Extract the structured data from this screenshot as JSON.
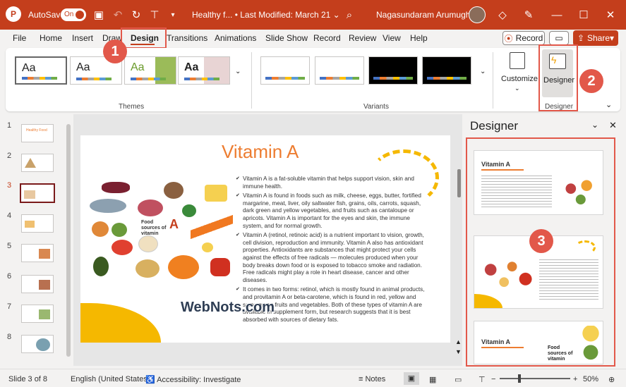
{
  "titlebar": {
    "autosave_label": "AutoSave",
    "autosave_state": "On",
    "doc_title": "Healthy f...",
    "last_modified": "Last Modified: March 21",
    "user_name": "Nagasundaram Arumugham"
  },
  "menu": {
    "tabs": [
      "File",
      "Home",
      "Insert",
      "Draw",
      "Design",
      "Transitions",
      "Animations",
      "Slide Show",
      "Record",
      "Review",
      "View",
      "Help"
    ],
    "active": "Design",
    "record_btn": "Record",
    "share_btn": "Share"
  },
  "ribbon": {
    "themes_label": "Themes",
    "variants_label": "Variants",
    "customize_label": "Customize",
    "designer_label": "Designer",
    "designer_group_label": "Designer",
    "theme_aa": "Aa"
  },
  "badges": [
    "1",
    "2",
    "3"
  ],
  "slides": {
    "numbers": [
      "1",
      "2",
      "3",
      "4",
      "5",
      "6",
      "7",
      "8"
    ],
    "active": "3",
    "thumb1_text": "Healthy Food"
  },
  "slide": {
    "title": "Vitamin A",
    "food_label": "Food sources of vitamin",
    "food_letter": "A",
    "bullets": [
      "Vitamin A is a fat-soluble vitamin that helps support vision, skin and immune health.",
      "Vitamin A is found in foods such as milk, cheese, eggs, butter, fortified margarine, meat, liver, oily saltwater fish, grains, oils, carrots, squash, dark green and yellow vegetables, and fruits such as cantaloupe or apricots. Vitamin A is important for the eyes and skin, the immune system, and for normal growth.",
      "Vitamin A (retinol, retinoic acid) is a nutrient important to vision, growth, cell division, reproduction and immunity. Vitamin A also has antioxidant properties. Antioxidants are substances that might protect your cells against the effects of free radicals — molecules produced when your body breaks down food or is exposed to tobacco smoke and radiation. Free radicals might play a role in heart disease, cancer and other diseases.",
      "It comes in two forms: retinol, which is mostly found in animal products, and provitamin A or beta-carotene, which is found in red, yellow and some green fruits and vegetables. Both of these types of vitamin A are available in supplement form, but research suggests that it is best absorbed with sources of dietary fats."
    ]
  },
  "watermark": "WebNots.com",
  "designer": {
    "title": "Designer",
    "card1_title": "Vitamin A",
    "card3_title": "Vitamin A",
    "card3_food_label": "Food sources of vitamin"
  },
  "status": {
    "slide_info": "Slide 3 of 8",
    "language": "English (United States)",
    "accessibility": "Accessibility: Investigate",
    "notes": "Notes",
    "zoom": "50%"
  },
  "colors": {
    "accent": "#c43e1c",
    "callout": "#e2584a",
    "title_orange": "#ed7d31"
  }
}
